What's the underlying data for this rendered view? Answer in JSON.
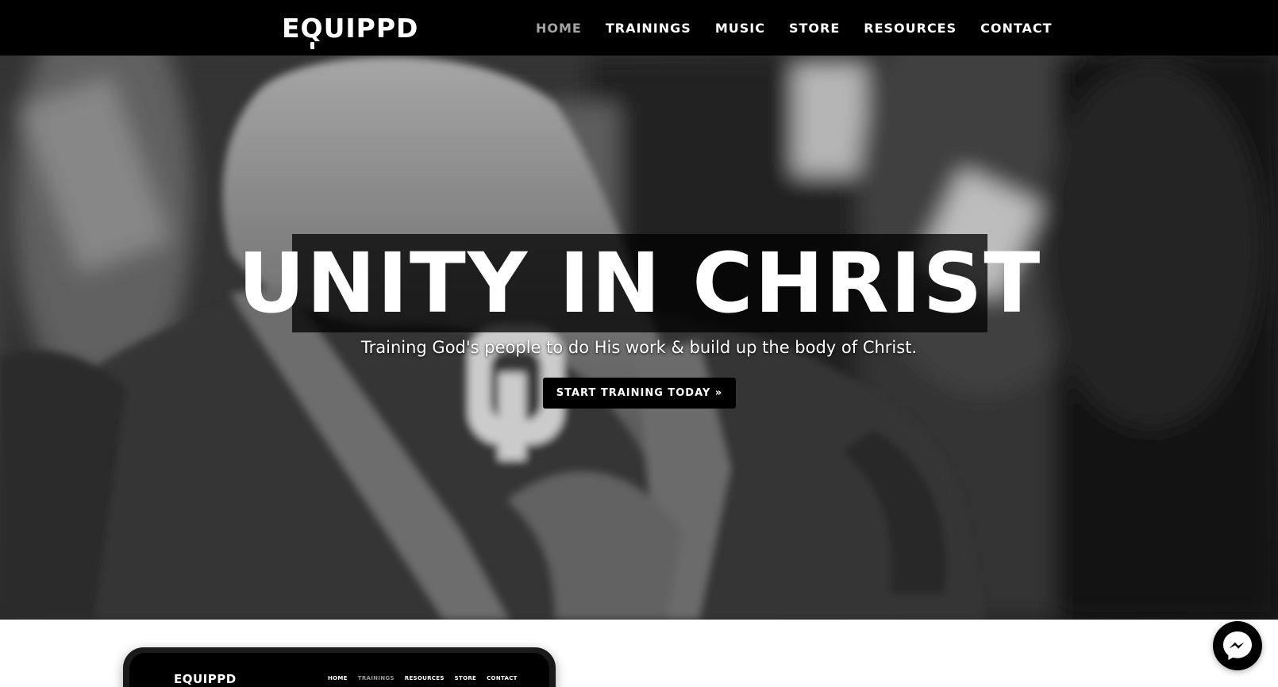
{
  "brand": {
    "logo": "EQUIPPD"
  },
  "nav": {
    "items": [
      {
        "label": "HOME",
        "active": true
      },
      {
        "label": "TRAININGS",
        "active": false
      },
      {
        "label": "MUSIC",
        "active": false
      },
      {
        "label": "STORE",
        "active": false
      },
      {
        "label": "RESOURCES",
        "active": false
      },
      {
        "label": "CONTACT",
        "active": false
      }
    ]
  },
  "hero": {
    "title": "UNITY IN CHRIST",
    "subtitle": "Training God's people to do His work & build up the body of Christ.",
    "cta_label": "START TRAINING TODAY »",
    "photo_icon": "blurred-bw-photo"
  },
  "device_preview": {
    "logo": "EQUIPPD",
    "nav": [
      "HOME",
      "TRAININGS",
      "RESOURCES",
      "STORE",
      "CONTACT"
    ],
    "active_index": 1
  },
  "chat": {
    "icon": "messenger-icon"
  },
  "colors": {
    "nav_background": "#000000",
    "nav_text": "#ffffff",
    "nav_active": "#a3a3a3",
    "cta_background": "#000000",
    "page_background": "#ffffff"
  }
}
